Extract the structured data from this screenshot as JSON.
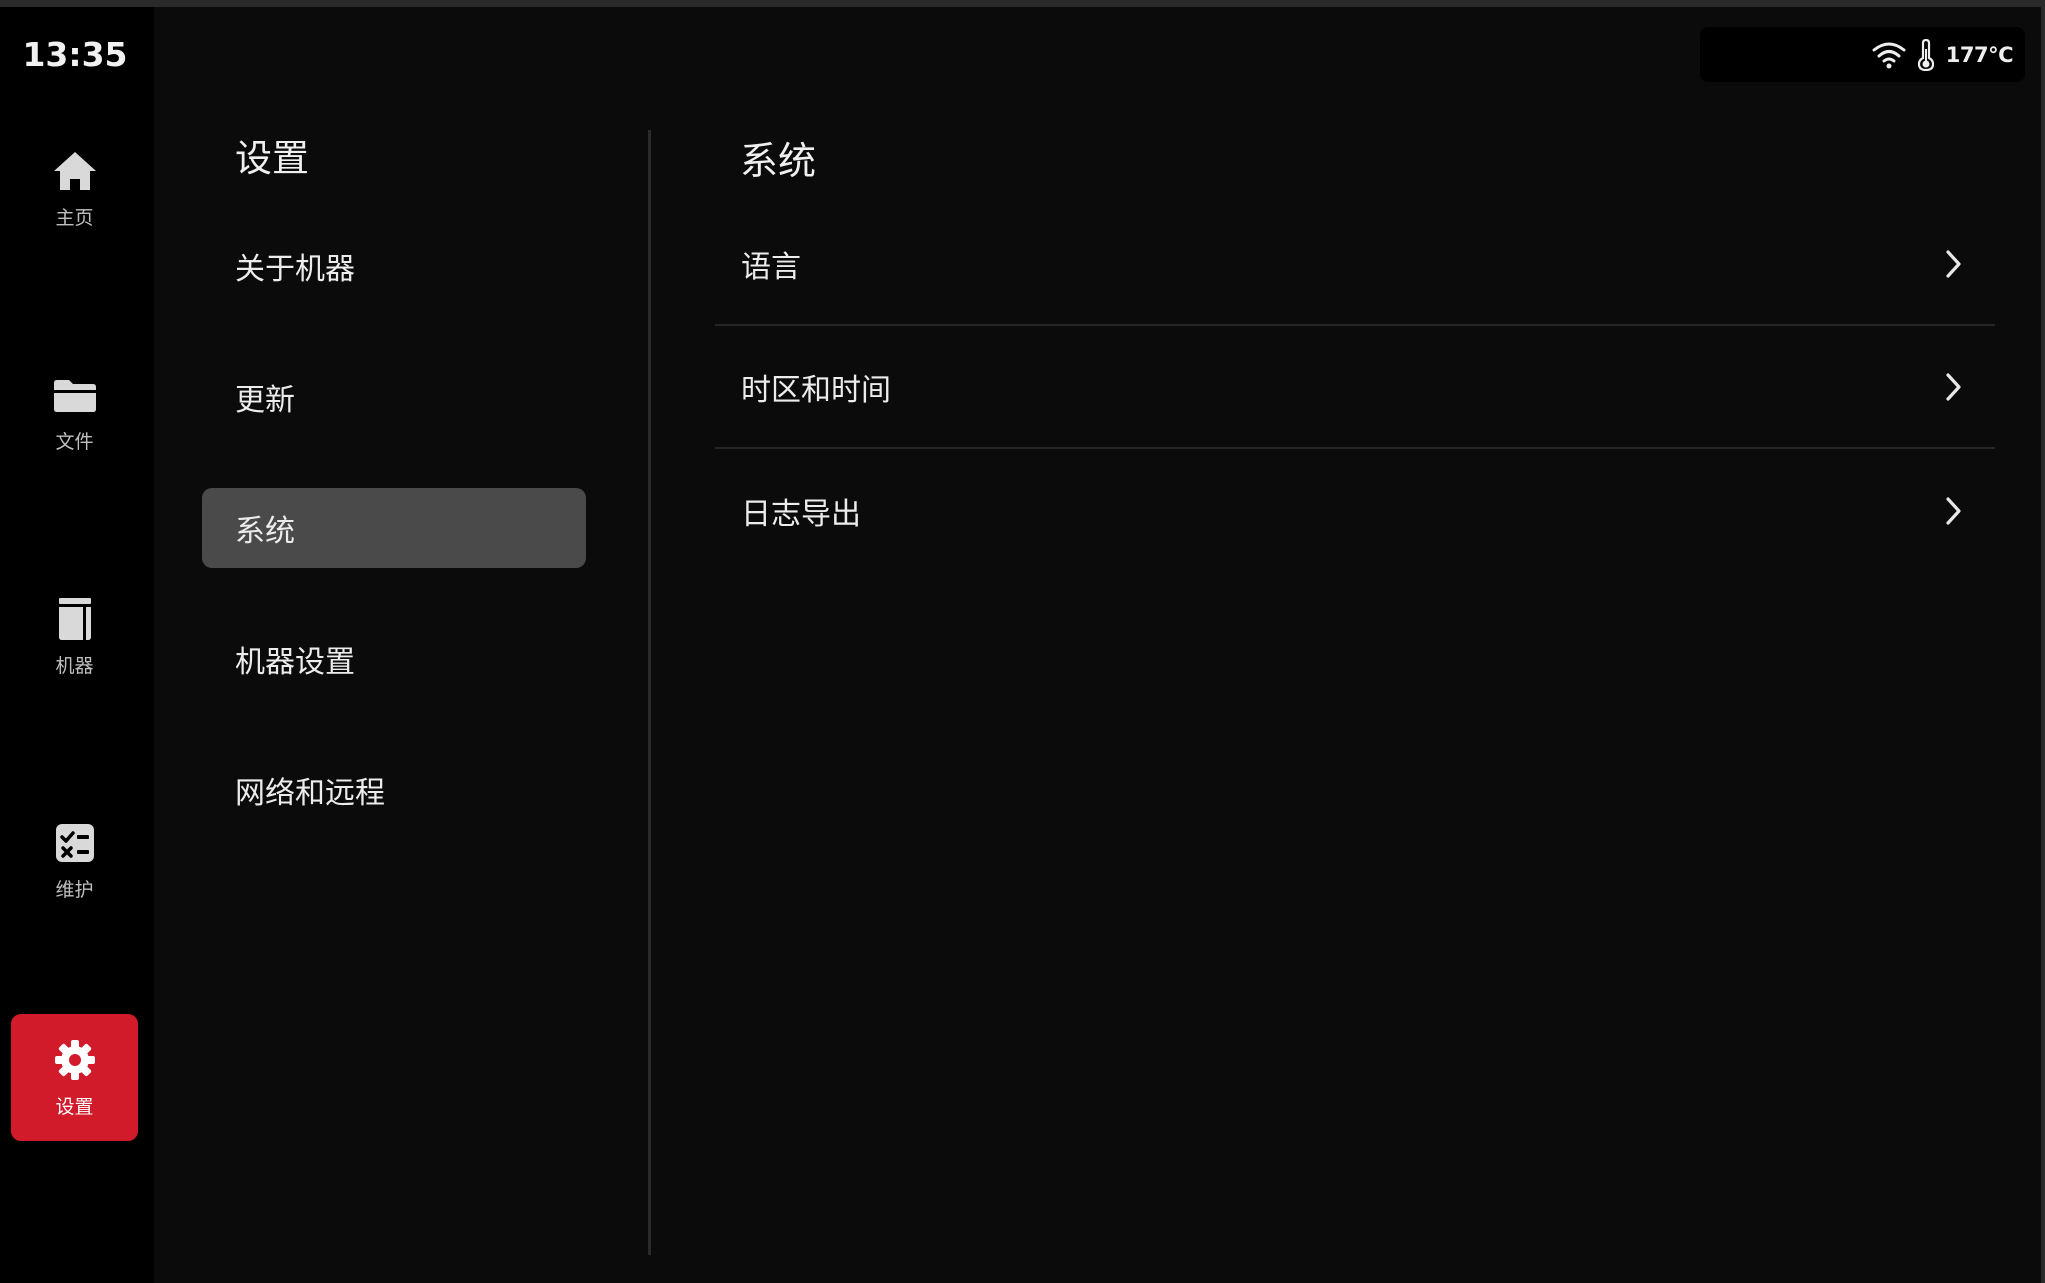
{
  "clock": "13:35",
  "status": {
    "temperature": "177℃",
    "wifi_icon": "wifi-icon",
    "thermometer_icon": "thermometer-icon"
  },
  "nav": {
    "items": [
      {
        "label": "主页",
        "icon": "home-icon"
      },
      {
        "label": "文件",
        "icon": "folder-icon"
      },
      {
        "label": "机器",
        "icon": "machine-icon"
      },
      {
        "label": "维护",
        "icon": "maintenance-icon"
      },
      {
        "label": "设置",
        "icon": "gear-icon",
        "active": true
      }
    ]
  },
  "settings_menu": {
    "title": "设置",
    "items": [
      {
        "label": "关于机器"
      },
      {
        "label": "更新"
      },
      {
        "label": "系统",
        "selected": true
      },
      {
        "label": "机器设置"
      },
      {
        "label": "网络和远程"
      }
    ]
  },
  "detail": {
    "title": "系统",
    "rows": [
      {
        "label": "语言"
      },
      {
        "label": "时区和时间"
      },
      {
        "label": "日志导出"
      }
    ]
  },
  "colors": {
    "accent": "#d11a2a",
    "selected_bg": "#4a4a4a",
    "background": "#0b0b0b",
    "rail_bg": "#000000"
  }
}
